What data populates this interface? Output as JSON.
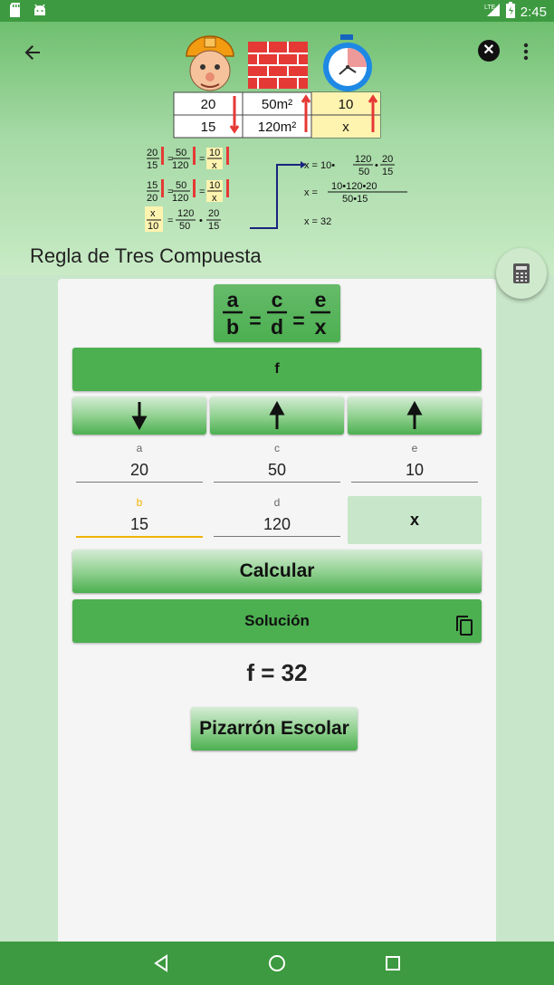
{
  "status_bar": {
    "time": "2:45",
    "network": "LTE"
  },
  "header": {
    "title": "Regla de Tres Compuesta"
  },
  "banner": {
    "table": [
      [
        "20",
        "50m²",
        "10"
      ],
      [
        "15",
        "120m²",
        "x"
      ]
    ],
    "eq1": "x = 10•",
    "eq2": "x =",
    "eq3": "x = 32",
    "eq2_num": "10•120•20",
    "eq2_den": "50•15"
  },
  "formula": {
    "a": "a",
    "b": "b",
    "c": "c",
    "d": "d",
    "e": "e",
    "x": "x"
  },
  "field_header": "f",
  "direction_arrows": [
    "down",
    "up",
    "up"
  ],
  "fields": [
    {
      "label": "a",
      "value": "20"
    },
    {
      "label": "c",
      "value": "50"
    },
    {
      "label": "e",
      "value": "10"
    },
    {
      "label": "b",
      "value": "15"
    },
    {
      "label": "d",
      "value": "120"
    },
    {
      "label": "x",
      "value": "x"
    }
  ],
  "calcular_label": "Calcular",
  "solucion_label": "Solución",
  "result_text": "f = 32",
  "pizarron_label": "Pizarrón Escolar",
  "colors": {
    "primary": "#4caf50",
    "dark": "#3d9a40",
    "accent": "#f0b400",
    "light": "#c8e6c9"
  }
}
